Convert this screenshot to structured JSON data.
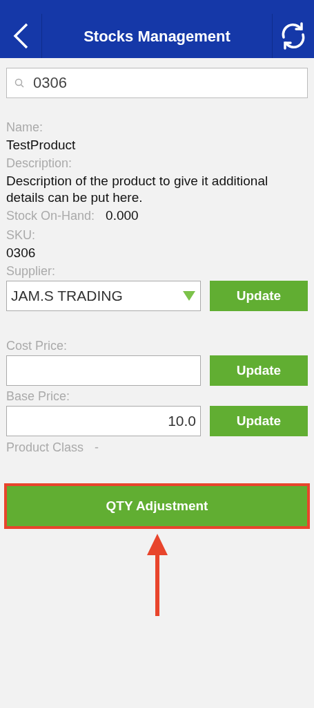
{
  "header": {
    "title": "Stocks Management"
  },
  "search": {
    "value": "0306"
  },
  "details": [
    {
      "kind": "label",
      "text": "Name:"
    },
    {
      "kind": "value",
      "text": "TestProduct"
    },
    {
      "kind": "label",
      "text": "Description:"
    },
    {
      "kind": "value",
      "text": "Description of the product to give it additional details can be put here."
    },
    {
      "kind": "pair",
      "text": "Stock On-Hand:",
      "value": "0.000"
    },
    {
      "kind": "label",
      "text": "SKU:"
    },
    {
      "kind": "value",
      "text": "0306"
    },
    {
      "kind": "label",
      "text": "Supplier:"
    }
  ],
  "supplier": {
    "value": "JAM.S TRADING",
    "button": "Update"
  },
  "cost_price": {
    "label": "Cost Price:",
    "button": "Update"
  },
  "base_price": {
    "label": "Base Price:",
    "value": "10.0",
    "button": "Update"
  },
  "product_class": {
    "label": "Product Class",
    "value": "-"
  },
  "qty_button": {
    "label": "QTY Adjustment",
    "highlighted": true
  }
}
